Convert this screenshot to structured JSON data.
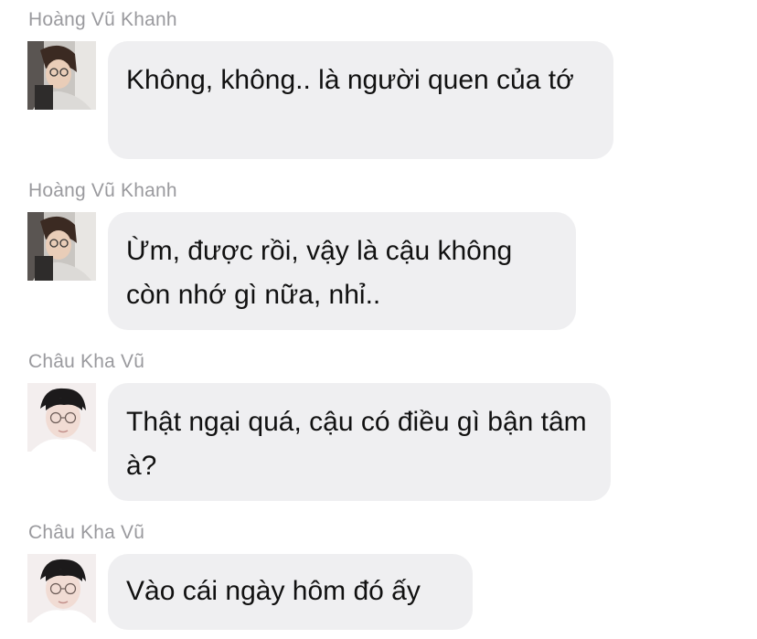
{
  "messages": [
    {
      "sender": "Hoàng Vũ Khanh",
      "avatar_icon": "user-avatar-photo-khanh",
      "text": "Không, không.. là người quen của tớ"
    },
    {
      "sender": "Hoàng Vũ Khanh",
      "avatar_icon": "user-avatar-photo-khanh",
      "text": "Ừm, được rồi, vậy là cậu không còn nhớ gì nữa, nhỉ.."
    },
    {
      "sender": "Châu Kha Vũ",
      "avatar_icon": "user-avatar-photo-vu",
      "text": "Thật ngại quá, cậu có điều gì bận tâm à?"
    },
    {
      "sender": "Châu Kha Vũ",
      "avatar_icon": "user-avatar-photo-vu",
      "text": "Vào cái ngày hôm đó ấy"
    }
  ],
  "colors": {
    "bubble_bg": "#efeff1",
    "sender_name": "#9a9a9e",
    "message_text": "#111111"
  }
}
